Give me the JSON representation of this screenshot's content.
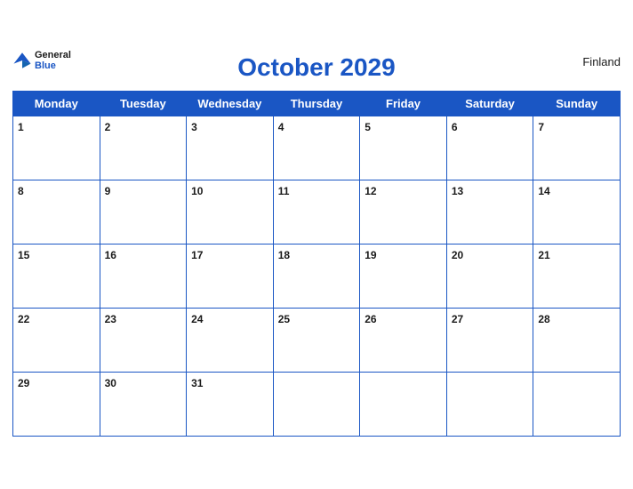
{
  "header": {
    "logo_general": "General",
    "logo_blue": "Blue",
    "title": "October 2029",
    "country": "Finland"
  },
  "weekdays": [
    "Monday",
    "Tuesday",
    "Wednesday",
    "Thursday",
    "Friday",
    "Saturday",
    "Sunday"
  ],
  "weeks": [
    {
      "days": [
        {
          "num": "1",
          "empty": false
        },
        {
          "num": "2",
          "empty": false
        },
        {
          "num": "3",
          "empty": false
        },
        {
          "num": "4",
          "empty": false
        },
        {
          "num": "5",
          "empty": false
        },
        {
          "num": "6",
          "empty": false
        },
        {
          "num": "7",
          "empty": false
        }
      ]
    },
    {
      "days": [
        {
          "num": "8",
          "empty": false
        },
        {
          "num": "9",
          "empty": false
        },
        {
          "num": "10",
          "empty": false
        },
        {
          "num": "11",
          "empty": false
        },
        {
          "num": "12",
          "empty": false
        },
        {
          "num": "13",
          "empty": false
        },
        {
          "num": "14",
          "empty": false
        }
      ]
    },
    {
      "days": [
        {
          "num": "15",
          "empty": false
        },
        {
          "num": "16",
          "empty": false
        },
        {
          "num": "17",
          "empty": false
        },
        {
          "num": "18",
          "empty": false
        },
        {
          "num": "19",
          "empty": false
        },
        {
          "num": "20",
          "empty": false
        },
        {
          "num": "21",
          "empty": false
        }
      ]
    },
    {
      "days": [
        {
          "num": "22",
          "empty": false
        },
        {
          "num": "23",
          "empty": false
        },
        {
          "num": "24",
          "empty": false
        },
        {
          "num": "25",
          "empty": false
        },
        {
          "num": "26",
          "empty": false
        },
        {
          "num": "27",
          "empty": false
        },
        {
          "num": "28",
          "empty": false
        }
      ]
    },
    {
      "days": [
        {
          "num": "29",
          "empty": false
        },
        {
          "num": "30",
          "empty": false
        },
        {
          "num": "31",
          "empty": false
        },
        {
          "num": "",
          "empty": true
        },
        {
          "num": "",
          "empty": true
        },
        {
          "num": "",
          "empty": true
        },
        {
          "num": "",
          "empty": true
        }
      ]
    }
  ],
  "colors": {
    "blue": "#1a56c4",
    "white": "#ffffff",
    "text": "#1a1a1a"
  }
}
